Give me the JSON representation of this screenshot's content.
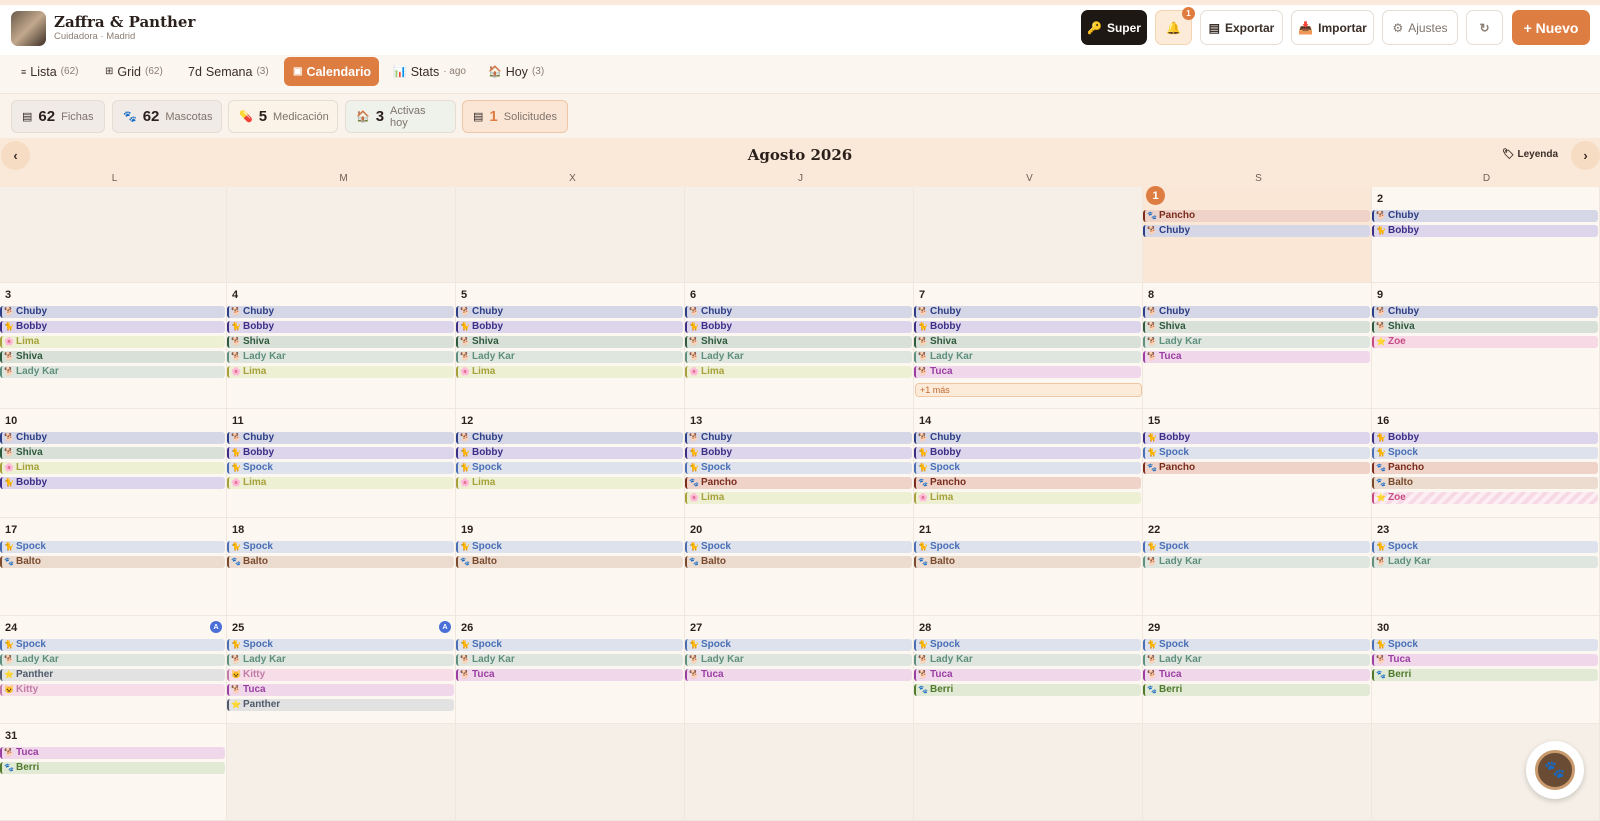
{
  "header": {
    "title": "Zaffra & Panther",
    "subtitle": "Cuidadora · Madrid",
    "super_label": "Super",
    "bell_count": "1",
    "export_label": "Exportar",
    "import_label": "Importar",
    "settings_label": "Ajustes",
    "new_label": "+ Nuevo"
  },
  "tabs": [
    {
      "label": "Lista",
      "count": "(62)",
      "icon": "list-icon"
    },
    {
      "label": "Grid",
      "count": "(62)",
      "icon": "grid-icon"
    },
    {
      "label": "Semana",
      "count": "(3)",
      "prefix": "7d",
      "icon": "week-icon"
    },
    {
      "label": "Calendario",
      "count": "",
      "icon": "calendar-icon",
      "active": true
    },
    {
      "label": "Stats",
      "count": "· ago",
      "icon": "chart-icon"
    },
    {
      "label": "Hoy",
      "count": "(3)",
      "icon": "house-icon"
    }
  ],
  "stats": [
    {
      "num": "62",
      "label": "Fichas"
    },
    {
      "num": "62",
      "label": "Mascotas"
    },
    {
      "num": "5",
      "label": "Medicación"
    },
    {
      "num": "3",
      "label": "Activas hoy"
    },
    {
      "num": "1",
      "label": "Solicitudes"
    }
  ],
  "calendar": {
    "month": "Agosto 2026",
    "legend_label": "Leyenda",
    "weekdays": [
      "L",
      "M",
      "X",
      "J",
      "V",
      "S",
      "D"
    ],
    "today": "1",
    "more_label": "+1 más",
    "days": [
      {
        "d": "1",
        "ev": [
          "Pancho",
          "Chuby"
        ]
      },
      {
        "d": "2",
        "ev": [
          "Chuby",
          "Bobby"
        ]
      },
      {
        "d": "3",
        "ev": [
          "Chuby",
          "Bobby",
          "Lima",
          "Shiva",
          "Lady Kar"
        ]
      },
      {
        "d": "4",
        "ev": [
          "Chuby",
          "Bobby",
          "Shiva",
          "Lady Kar",
          "Lima"
        ]
      },
      {
        "d": "5",
        "ev": [
          "Chuby",
          "Bobby",
          "Shiva",
          "Lady Kar",
          "Lima"
        ]
      },
      {
        "d": "6",
        "ev": [
          "Chuby",
          "Bobby",
          "Shiva",
          "Lady Kar",
          "Lima"
        ]
      },
      {
        "d": "7",
        "ev": [
          "Chuby",
          "Bobby",
          "Shiva",
          "Lady Kar",
          "Tuca"
        ]
      },
      {
        "d": "8",
        "ev": [
          "Chuby",
          "Shiva",
          "Lady Kar",
          "Tuca"
        ]
      },
      {
        "d": "9",
        "ev": [
          "Chuby",
          "Shiva",
          "Zoe"
        ]
      },
      {
        "d": "10",
        "ev": [
          "Chuby",
          "Shiva",
          "Lima",
          "Bobby"
        ]
      },
      {
        "d": "11",
        "ev": [
          "Chuby",
          "Bobby",
          "Spock",
          "Lima"
        ]
      },
      {
        "d": "12",
        "ev": [
          "Chuby",
          "Bobby",
          "Spock",
          "Lima"
        ]
      },
      {
        "d": "13",
        "ev": [
          "Chuby",
          "Bobby",
          "Spock",
          "Pancho",
          "Lima"
        ]
      },
      {
        "d": "14",
        "ev": [
          "Chuby",
          "Bobby",
          "Spock",
          "Pancho",
          "Lima"
        ]
      },
      {
        "d": "15",
        "ev": [
          "Bobby",
          "Spock",
          "Pancho"
        ]
      },
      {
        "d": "16",
        "ev": [
          "Bobby",
          "Spock",
          "Pancho",
          "Balto",
          "Zoe"
        ]
      },
      {
        "d": "17",
        "ev": [
          "Spock",
          "Balto"
        ]
      },
      {
        "d": "18",
        "ev": [
          "Spock",
          "Balto"
        ]
      },
      {
        "d": "19",
        "ev": [
          "Spock",
          "Balto"
        ]
      },
      {
        "d": "20",
        "ev": [
          "Spock",
          "Balto"
        ]
      },
      {
        "d": "21",
        "ev": [
          "Spock",
          "Balto"
        ]
      },
      {
        "d": "22",
        "ev": [
          "Spock",
          "Lady Kar"
        ]
      },
      {
        "d": "23",
        "ev": [
          "Spock",
          "Lady Kar"
        ]
      },
      {
        "d": "24",
        "ev": [
          "Spock",
          "Lady Kar",
          "Panther",
          "Kitty"
        ]
      },
      {
        "d": "25",
        "ev": [
          "Spock",
          "Lady Kar",
          "Kitty",
          "Tuca",
          "Panther"
        ]
      },
      {
        "d": "26",
        "ev": [
          "Spock",
          "Lady Kar",
          "Tuca"
        ]
      },
      {
        "d": "27",
        "ev": [
          "Spock",
          "Lady Kar",
          "Tuca"
        ]
      },
      {
        "d": "28",
        "ev": [
          "Spock",
          "Lady Kar",
          "Tuca",
          "Berri"
        ]
      },
      {
        "d": "29",
        "ev": [
          "Spock",
          "Lady Kar",
          "Tuca",
          "Berri"
        ]
      },
      {
        "d": "30",
        "ev": [
          "Spock",
          "Tuca",
          "Berri"
        ]
      },
      {
        "d": "31",
        "ev": [
          "Tuca",
          "Berri"
        ]
      }
    ]
  },
  "colors": {
    "accent": "#de7d42",
    "Chuby": "#d5d6e6",
    "Bobby": "#dcd5ec",
    "Lima": "#eef0d4",
    "Shiva": "#d8e0d8",
    "Lady Kar": "#dfe6e0",
    "Tuca": "#f0d8ea",
    "Zoe": "#f6d9e4",
    "Spock": "#dde2ec",
    "Pancho": "#efd3c9",
    "Balto": "#ecdcd0",
    "Panther": "#e2e2e2",
    "Kitty": "#f6dde8",
    "Berri": "#e2ead6"
  }
}
